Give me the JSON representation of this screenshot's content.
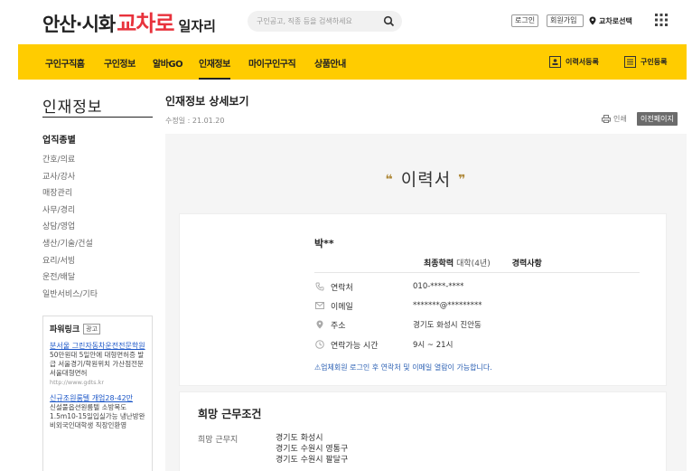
{
  "header": {
    "logo_part1": "안산·시화",
    "logo_part2": "교차로",
    "logo_part3": "일자리",
    "search_placeholder": "구인공고, 직종 등을 검색하세요",
    "login": "로그인",
    "join": "회원가입",
    "region": "교차로선택"
  },
  "nav": {
    "items": [
      "구인구직홈",
      "구인정보",
      "알바GO",
      "인재정보",
      "마이구인구직",
      "상품안내"
    ],
    "active_index": 3,
    "resume_register": "이력서등록",
    "job_register": "구인등록"
  },
  "sidebar": {
    "title": "인재정보",
    "category_heading": "업직종별",
    "categories": [
      "간호/의료",
      "교사/강사",
      "매장관리",
      "사무/경리",
      "상담/영업",
      "생산/기술/건설",
      "요리/서빙",
      "운전/배달",
      "일반서비스/기타"
    ],
    "ad": {
      "heading": "파워링크",
      "tag": "광고",
      "ads": [
        {
          "title": "분서울 그린자동차운전전문학원",
          "desc": "50만원대 5일안에 대형면허증 발급 서울경기/학원위치 가산점전문 서울대형면허",
          "url": "http://www.gdts.kr"
        },
        {
          "title": "신규조원룸텔 개업28-42만",
          "desc": "신설풀옵션원룸텔 소방복도1.5m10-15일입실가능 냉난방완비외국인대학생 직장인환영",
          "url": ""
        }
      ]
    }
  },
  "main": {
    "title": "인재정보 상세보기",
    "modified": "수정일 : 21.01.20",
    "print": "인쇄",
    "prev_page": "이전페이지",
    "resume_heading": "이력서",
    "name": "박**",
    "education_label": "최종학력",
    "education_value": "대학(4년)",
    "career_label": "경력사항",
    "info": [
      {
        "icon": "phone-icon",
        "label": "연락처",
        "value": "010-****-****"
      },
      {
        "icon": "mail-icon",
        "label": "이메일",
        "value": "*******@*********"
      },
      {
        "icon": "location-icon",
        "label": "주소",
        "value": "경기도 화성시 진안동"
      },
      {
        "icon": "clock-icon",
        "label": "연락가능 시간",
        "value": "9시 ~ 21시"
      }
    ],
    "notice": "업체회원 로그인 후 연락처 및 이메일 열람이 가능합니다.",
    "desired": {
      "heading": "희망 근무조건",
      "area_label": "희망 근무지",
      "areas": [
        "경기도 화성시",
        "경기도 수원시 영통구",
        "경기도 수원시 팔달구"
      ]
    }
  },
  "colors": {
    "brand_yellow": "#ffcc00",
    "brand_red": "#e8323c",
    "link_blue": "#1a55c7"
  }
}
